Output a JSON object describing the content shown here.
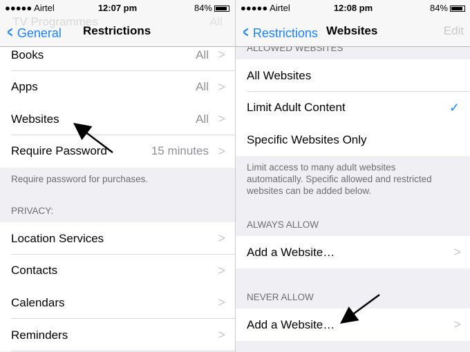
{
  "left": {
    "status": {
      "carrier": "●●●●● Airtel",
      "time": "12:07 pm",
      "battery": "84%"
    },
    "nav": {
      "ghost_title": "TV Programmes",
      "ghost_value": "All",
      "back": "General",
      "title": "Restrictions"
    },
    "rows": [
      {
        "label": "Books",
        "value": "All"
      },
      {
        "label": "Apps",
        "value": "All"
      },
      {
        "label": "Websites",
        "value": "All"
      },
      {
        "label": "Require Password",
        "value": "15 minutes"
      }
    ],
    "footer": "Require password for purchases.",
    "privacy_header": "PRIVACY:",
    "privacy_rows": [
      {
        "label": "Location Services"
      },
      {
        "label": "Contacts"
      },
      {
        "label": "Calendars"
      },
      {
        "label": "Reminders"
      }
    ]
  },
  "right": {
    "status": {
      "carrier": "●●●●● Airtel",
      "time": "12:08 pm",
      "battery": "84%"
    },
    "nav": {
      "back": "Restrictions",
      "title": "Websites",
      "edit": "Edit"
    },
    "allowed_header": "ALLOWED WEBSITES",
    "options": [
      {
        "label": "All Websites"
      },
      {
        "label": "Limit Adult Content",
        "checked": true
      },
      {
        "label": "Specific Websites Only"
      }
    ],
    "footer": "Limit access to many adult websites automatically. Specific allowed and restricted websites can be added below.",
    "always_header": "ALWAYS ALLOW",
    "always_add": "Add a Website…",
    "never_header": "NEVER ALLOW",
    "never_add": "Add a Website…"
  },
  "colors": {
    "accent": "#1a82fb",
    "background": "#efeff4"
  }
}
